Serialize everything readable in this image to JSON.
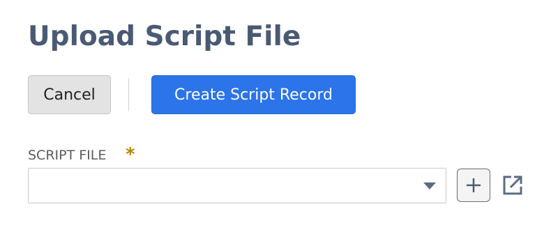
{
  "page": {
    "title": "Upload Script File"
  },
  "toolbar": {
    "cancel_label": "Cancel",
    "create_label": "Create Script Record"
  },
  "form": {
    "script_file": {
      "label": "SCRIPT FILE",
      "required_marker": "*",
      "value": ""
    }
  },
  "icons": {
    "dropdown": "chevron-down-icon",
    "add": "plus-icon",
    "open": "external-link-icon"
  },
  "colors": {
    "title": "#4a5a74",
    "primary": "#2b74ea",
    "required": "#b8860b"
  }
}
